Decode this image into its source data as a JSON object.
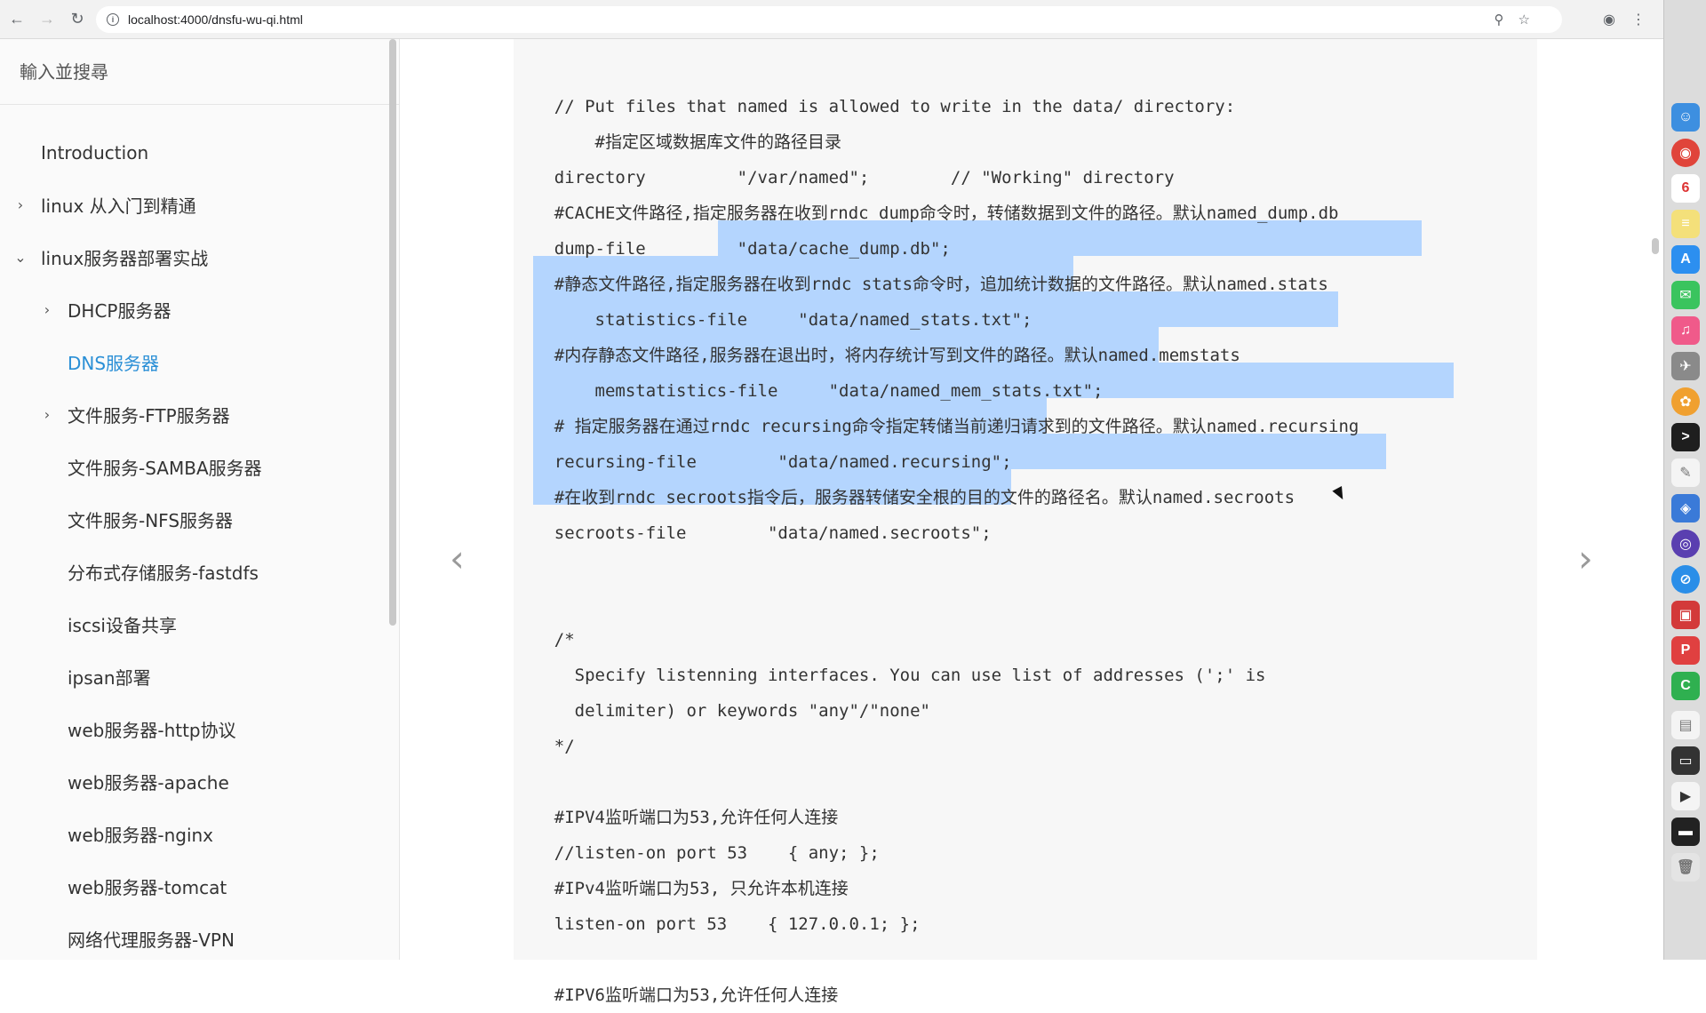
{
  "browser": {
    "url": "localhost:4000/dnsfu-wu-qi.html"
  },
  "sidebar": {
    "search_placeholder": "輸入並搜尋",
    "items": [
      {
        "label": "Introduction",
        "level": 1,
        "chevron": ""
      },
      {
        "label": "linux 从入门到精通",
        "level": 1,
        "chevron": "›"
      },
      {
        "label": "linux服务器部署实战",
        "level": 1,
        "chevron": "⌄"
      },
      {
        "label": "DHCP服务器",
        "level": 2,
        "chevron": "›"
      },
      {
        "label": "DNS服务器",
        "level": 2,
        "chevron": "",
        "active": true
      },
      {
        "label": "文件服务-FTP服务器",
        "level": 2,
        "chevron": "›"
      },
      {
        "label": "文件服务-SAMBA服务器",
        "level": 2,
        "chevron": ""
      },
      {
        "label": "文件服务-NFS服务器",
        "level": 2,
        "chevron": ""
      },
      {
        "label": "分布式存储服务-fastdfs",
        "level": 2,
        "chevron": ""
      },
      {
        "label": "iscsi设备共享",
        "level": 2,
        "chevron": ""
      },
      {
        "label": "ipsan部署",
        "level": 2,
        "chevron": ""
      },
      {
        "label": "web服务器-http协议",
        "level": 2,
        "chevron": ""
      },
      {
        "label": "web服务器-apache",
        "level": 2,
        "chevron": ""
      },
      {
        "label": "web服务器-nginx",
        "level": 2,
        "chevron": ""
      },
      {
        "label": "web服务器-tomcat",
        "level": 2,
        "chevron": ""
      },
      {
        "label": "网络代理服务器-VPN",
        "level": 2,
        "chevron": ""
      }
    ]
  },
  "code": {
    "lines": [
      "    // Put files that named is allowed to write in the data/ directory:",
      "        #指定区域数据库文件的路径目录",
      "    directory         \"/var/named\";        // \"Working\" directory",
      "    #CACHE文件路径,指定服务器在收到rndc dump命令时，转储数据到文件的路径。默认named_dump.db",
      "    dump-file         \"data/cache_dump.db\";",
      "    #静态文件路径,指定服务器在收到rndc stats命令时，追加统计数据的文件路径。默认named.stats",
      "        statistics-file     \"data/named_stats.txt\";",
      "    #内存静态文件路径,服务器在退出时，将内存统计写到文件的路径。默认named.memstats",
      "        memstatistics-file     \"data/named_mem_stats.txt\";",
      "    # 指定服务器在通过rndc recursing命令指定转储当前递归请求到的文件路径。默认named.recursing",
      "    recursing-file        \"data/named.recursing\";",
      "    #在收到rndc secroots指令后，服务器转储安全根的目的文件的路径名。默认named.secroots",
      "    secroots-file        \"data/named.secroots\";",
      "",
      "",
      "    /*",
      "      Specify listenning interfaces. You can use list of addresses (';' is",
      "      delimiter) or keywords \"any\"/\"none\"",
      "    */",
      "",
      "    #IPV4监听端口为53,允许任何人连接",
      "    //listen-on port 53    { any; };",
      "    #IPv4监听端口为53, 只允许本机连接",
      "    listen-on port 53    { 127.0.0.1; };",
      "",
      "    #IPV6监听端口为53,允许任何人连接"
    ]
  },
  "nav": {
    "prev": "‹",
    "next": "›"
  }
}
